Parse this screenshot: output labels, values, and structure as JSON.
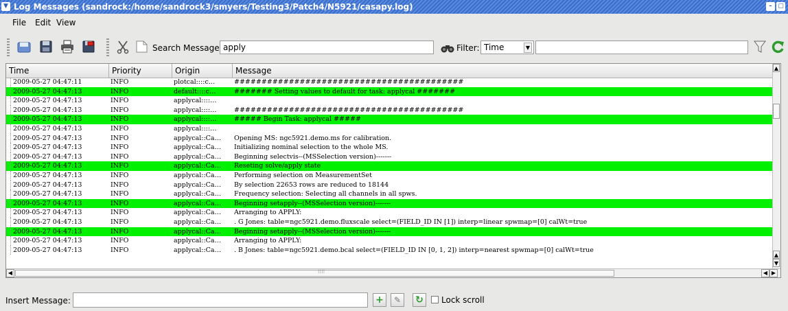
{
  "window": {
    "title": "Log Messages (sandrock:/home/sandrock3/smyers/Testing3/Patch4/N5921/casapy.log)",
    "menu_glyph": "▼",
    "minimize": "–",
    "restore": "▢",
    "close": "✕"
  },
  "menubar": {
    "file": "File",
    "edit": "Edit",
    "view": "View"
  },
  "toolbar": {
    "search_label": "Search Message:",
    "search_value": "apply",
    "filter_label": "Filter:",
    "filter_selected": "Time",
    "filter_value": "",
    "icons": [
      "save-as-icon",
      "save-icon",
      "print-icon",
      "save-pdf-icon",
      "cut-icon",
      "copy-icon",
      "binoculars-icon",
      "funnel-icon",
      "refresh-icon"
    ],
    "accent": "#2f9b2f"
  },
  "table": {
    "columns": [
      "Time",
      "Priority",
      "Origin",
      "Message"
    ],
    "highlight_color": "#00f000",
    "rows": [
      {
        "time": "2009-05-27 04:47:11",
        "priority": "INFO",
        "origin": "plotcal::::c…",
        "message": "##########################################",
        "hl": false
      },
      {
        "time": "2009-05-27 04:47:13",
        "priority": "INFO",
        "origin": "default::::c…",
        "message": " #######  Setting values to default for task: applycal  #######",
        "hl": true
      },
      {
        "time": "2009-05-27 04:47:13",
        "priority": "INFO",
        "origin": "applycal::::…",
        "message": "",
        "hl": false
      },
      {
        "time": "2009-05-27 04:47:13",
        "priority": "INFO",
        "origin": "applycal::::…",
        "message": "##########################################",
        "hl": false
      },
      {
        "time": "2009-05-27 04:47:13",
        "priority": "INFO",
        "origin": "applycal::::…",
        "message": "##### Begin Task: applycal           #####",
        "hl": true
      },
      {
        "time": "2009-05-27 04:47:13",
        "priority": "INFO",
        "origin": "applycal::::…",
        "message": "",
        "hl": false
      },
      {
        "time": "2009-05-27 04:47:13",
        "priority": "INFO",
        "origin": "applycal::Ca…",
        "message": "Opening MS: ngc5921.demo.ms for calibration.",
        "hl": false
      },
      {
        "time": "2009-05-27 04:47:13",
        "priority": "INFO",
        "origin": "applycal::Ca…",
        "message": "Initializing nominal selection to the whole MS.",
        "hl": false
      },
      {
        "time": "2009-05-27 04:47:13",
        "priority": "INFO",
        "origin": "applycal::Ca…",
        "message": "Beginning selectvis--(MSSelection version)-------",
        "hl": false
      },
      {
        "time": "2009-05-27 04:47:13",
        "priority": "INFO",
        "origin": "applycal::Ca…",
        "message": "Reseting solve/apply state",
        "hl": true
      },
      {
        "time": "2009-05-27 04:47:13",
        "priority": "INFO",
        "origin": "applycal::Ca…",
        "message": "Performing selection on MeasurementSet",
        "hl": false
      },
      {
        "time": "2009-05-27 04:47:13",
        "priority": "INFO",
        "origin": "applycal::Ca…",
        "message": "By selection 22653 rows are reduced to 18144",
        "hl": false
      },
      {
        "time": "2009-05-27 04:47:13",
        "priority": "INFO",
        "origin": "applycal::Ca…",
        "message": "Frequency selection: Selecting all channels in all spws.",
        "hl": false
      },
      {
        "time": "2009-05-27 04:47:13",
        "priority": "INFO",
        "origin": "applycal::Ca…",
        "message": "Beginning setapply--(MSSelection version)-------",
        "hl": true
      },
      {
        "time": "2009-05-27 04:47:13",
        "priority": "INFO",
        "origin": "applycal::Ca…",
        "message": "Arranging to APPLY:",
        "hl": false
      },
      {
        "time": "2009-05-27 04:47:13",
        "priority": "INFO",
        "origin": "applycal::Ca…",
        "message": ".   G Jones: table=ngc5921.demo.fluxscale select=(FIELD_ID IN [1]) interp=linear spwmap=[0] calWt=true",
        "hl": false
      },
      {
        "time": "2009-05-27 04:47:13",
        "priority": "INFO",
        "origin": "applycal::Ca…",
        "message": "Beginning setapply--(MSSelection version)-------",
        "hl": true
      },
      {
        "time": "2009-05-27 04:47:13",
        "priority": "INFO",
        "origin": "applycal::Ca…",
        "message": "Arranging to APPLY:",
        "hl": false
      },
      {
        "time": "2009-05-27 04:47:13",
        "priority": "INFO",
        "origin": "applycal::Ca…",
        "message": ".   B Jones: table=ngc5921.demo.bcal select=(FIELD_ID IN [0, 1, 2]) interp=nearest spwmap=[0] calWt=true",
        "hl": false
      }
    ],
    "scroll_up": "▲",
    "scroll_down": "▼",
    "scroll_left": "◀",
    "scroll_right": "▶",
    "hscroll_grip": "⁞⁞⁞⁞"
  },
  "bottom": {
    "insert_label": "Insert Message:",
    "insert_value": "",
    "add_glyph": "+",
    "edit_glyph": "✎",
    "refresh_glyph": "↻",
    "lock_scroll_label": "Lock scroll",
    "lock_scroll_checked": false
  }
}
